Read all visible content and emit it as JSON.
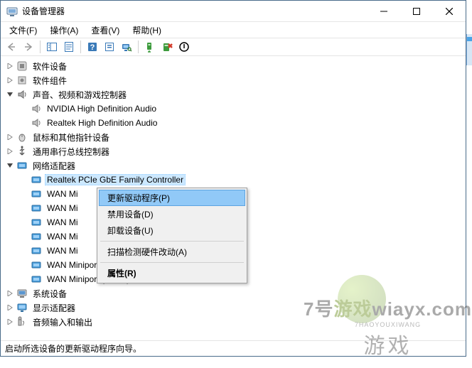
{
  "titlebar": {
    "title": "设备管理器"
  },
  "menu": {
    "file": "文件(F)",
    "action": "操作(A)",
    "view": "查看(V)",
    "help": "帮助(H)"
  },
  "tree": {
    "software_devices": "软件设备",
    "software_components": "软件组件",
    "sound_controllers": "声音、视频和游戏控制器",
    "nvidia_audio": "NVIDIA High Definition Audio",
    "realtek_audio": "Realtek High Definition Audio",
    "mice": "鼠标和其他指针设备",
    "usb_controllers": "通用串行总线控制器",
    "network_adapters": "网络适配器",
    "realtek_nic": "Realtek PCIe GbE Family Controller",
    "wan_mi": "WAN Mi",
    "wan_pptp": "WAN Miniport (PPTP)",
    "wan_sstp": "WAN Miniport (SSTP)",
    "system_devices": "系统设备",
    "display_adapters": "显示适配器",
    "audio_io": "音频输入和输出"
  },
  "context_menu": {
    "update_driver": "更新驱动程序(P)",
    "disable_device": "禁用设备(D)",
    "uninstall_device": "卸载设备(U)",
    "scan_hardware": "扫描检测硬件改动(A)",
    "properties": "属性(R)"
  },
  "statusbar": {
    "text": "启动所选设备的更新驱动程序向导。"
  },
  "watermark": {
    "line1_a": "7号",
    "line1_b": "游戏",
    "small": "7HAOYOUXIWANG",
    "line2": "游戏"
  }
}
